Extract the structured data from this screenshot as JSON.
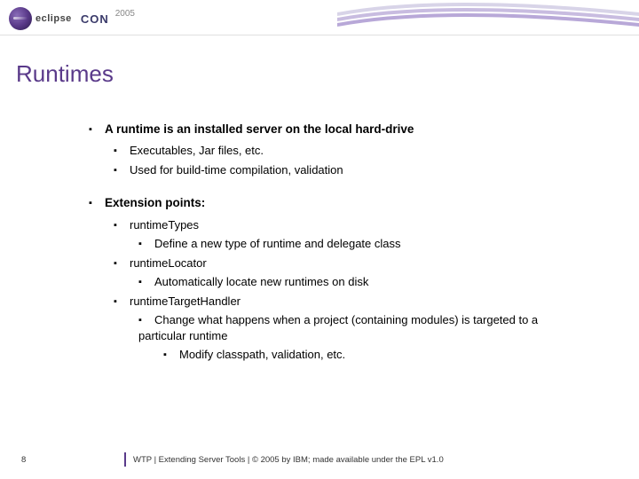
{
  "header": {
    "logo_eclipse": "eclipse",
    "logo_con": "CON",
    "logo_year": "2005"
  },
  "title": "Runtimes",
  "bullets": {
    "p1": "A runtime is an installed server on the local hard-drive",
    "p1a": "Executables, Jar files, etc.",
    "p1b": "Used for build-time compilation, validation",
    "p2": "Extension points:",
    "p2a": "runtimeTypes",
    "p2a1": "Define a new type of runtime and delegate class",
    "p2b": "runtimeLocator",
    "p2b1": "Automatically locate new runtimes on disk",
    "p2c": "runtimeTargetHandler",
    "p2c1": "Change what happens when a project (containing modules) is targeted to a particular runtime",
    "p2c1a": "Modify classpath, validation, etc."
  },
  "footer": {
    "page": "8",
    "text": "WTP  |  Extending Server Tools  |  © 2005 by IBM; made available under the EPL v1.0"
  }
}
